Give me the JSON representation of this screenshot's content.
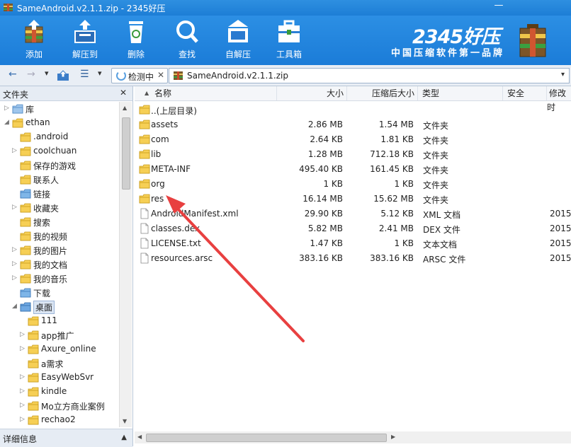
{
  "window": {
    "title": "SameAndroid.v2.1.1.zip - 2345好压",
    "minimize_glyph": "—"
  },
  "toolbar": {
    "buttons": [
      {
        "label": "添加",
        "icon": "add-archive-icon"
      },
      {
        "label": "解压到",
        "icon": "extract-icon"
      },
      {
        "label": "删除",
        "icon": "recycle-bin-icon"
      },
      {
        "label": "查找",
        "icon": "magnifier-icon"
      },
      {
        "label": "自解压",
        "icon": "self-extract-icon"
      },
      {
        "label": "工具箱",
        "icon": "toolbox-icon"
      }
    ]
  },
  "brand": {
    "logo": "2345好压",
    "slogan": "中国压缩软件第一品牌"
  },
  "addressbar": {
    "back": "←",
    "forward": "→",
    "dropdown": "▾",
    "view": "☰",
    "tab_label": "检测中",
    "tab_close": "✕",
    "path": "SameAndroid.v2.1.1.zip"
  },
  "left_panel": {
    "header": "文件夹",
    "close": "✕",
    "footer": "详细信息",
    "footer_toggle": "▲",
    "tree": [
      {
        "label": "库",
        "level": 0,
        "expand": "collapsed",
        "icon": "library-icon"
      },
      {
        "label": "ethan",
        "level": 0,
        "expand": "expanded",
        "icon": "user-folder-icon"
      },
      {
        "label": ".android",
        "level": 1,
        "expand": "none",
        "icon": "folder-icon"
      },
      {
        "label": "coolchuan",
        "level": 1,
        "expand": "collapsed",
        "icon": "folder-icon"
      },
      {
        "label": "保存的游戏",
        "level": 1,
        "expand": "none",
        "icon": "saved-games-icon"
      },
      {
        "label": "联系人",
        "level": 1,
        "expand": "none",
        "icon": "contacts-icon"
      },
      {
        "label": "链接",
        "level": 1,
        "expand": "none",
        "icon": "links-icon"
      },
      {
        "label": "收藏夹",
        "level": 1,
        "expand": "collapsed",
        "icon": "favorites-icon"
      },
      {
        "label": "搜索",
        "level": 1,
        "expand": "none",
        "icon": "search-folder-icon"
      },
      {
        "label": "我的视频",
        "level": 1,
        "expand": "none",
        "icon": "videos-icon"
      },
      {
        "label": "我的图片",
        "level": 1,
        "expand": "collapsed",
        "icon": "pictures-icon"
      },
      {
        "label": "我的文档",
        "level": 1,
        "expand": "collapsed",
        "icon": "documents-icon"
      },
      {
        "label": "我的音乐",
        "level": 1,
        "expand": "collapsed",
        "icon": "music-icon"
      },
      {
        "label": "下载",
        "level": 1,
        "expand": "none",
        "icon": "downloads-icon"
      },
      {
        "label": "桌面",
        "level": 1,
        "expand": "expanded",
        "icon": "desktop-icon",
        "selected": true
      },
      {
        "label": "111",
        "level": 2,
        "expand": "none",
        "icon": "folder-icon"
      },
      {
        "label": "app推广",
        "level": 2,
        "expand": "collapsed",
        "icon": "folder-icon"
      },
      {
        "label": "Axure_online",
        "level": 2,
        "expand": "collapsed",
        "icon": "folder-icon"
      },
      {
        "label": "a需求",
        "level": 2,
        "expand": "none",
        "icon": "folder-icon"
      },
      {
        "label": "EasyWebSvr",
        "level": 2,
        "expand": "collapsed",
        "icon": "folder-icon"
      },
      {
        "label": "kindle",
        "level": 2,
        "expand": "collapsed",
        "icon": "folder-icon"
      },
      {
        "label": "Mo立方商业案例",
        "level": 2,
        "expand": "collapsed",
        "icon": "folder-icon"
      },
      {
        "label": "rechao2",
        "level": 2,
        "expand": "collapsed",
        "icon": "folder-icon"
      }
    ]
  },
  "file_list": {
    "columns": [
      "名称",
      "大小",
      "压缩后大小",
      "类型",
      "安全",
      "修改时"
    ],
    "sort_indicator": "▲",
    "rows": [
      {
        "name": "..(上层目录)",
        "size": "",
        "packed": "",
        "type": "",
        "modified": "",
        "icon": "folder-up-icon"
      },
      {
        "name": "assets",
        "size": "2.86 MB",
        "packed": "1.54 MB",
        "type": "文件夹",
        "modified": "",
        "icon": "folder-icon"
      },
      {
        "name": "com",
        "size": "2.64 KB",
        "packed": "1.81 KB",
        "type": "文件夹",
        "modified": "",
        "icon": "folder-icon"
      },
      {
        "name": "lib",
        "size": "1.28 MB",
        "packed": "712.18 KB",
        "type": "文件夹",
        "modified": "",
        "icon": "folder-icon"
      },
      {
        "name": "META-INF",
        "size": "495.40 KB",
        "packed": "161.45 KB",
        "type": "文件夹",
        "modified": "",
        "icon": "folder-icon"
      },
      {
        "name": "org",
        "size": "1 KB",
        "packed": "1 KB",
        "type": "文件夹",
        "modified": "",
        "icon": "folder-icon"
      },
      {
        "name": "res",
        "size": "16.14 MB",
        "packed": "15.62 MB",
        "type": "文件夹",
        "modified": "",
        "icon": "folder-icon"
      },
      {
        "name": "AndroidManifest.xml",
        "size": "29.90 KB",
        "packed": "5.12 KB",
        "type": "XML 文档",
        "modified": "2015",
        "icon": "file-icon"
      },
      {
        "name": "classes.dex",
        "size": "5.82 MB",
        "packed": "2.41 MB",
        "type": "DEX 文件",
        "modified": "2015",
        "icon": "file-icon"
      },
      {
        "name": "LICENSE.txt",
        "size": "1.47 KB",
        "packed": "1 KB",
        "type": "文本文档",
        "modified": "2015",
        "icon": "file-icon"
      },
      {
        "name": "resources.arsc",
        "size": "383.16 KB",
        "packed": "383.16 KB",
        "type": "ARSC 文件",
        "modified": "2015",
        "icon": "file-icon"
      }
    ]
  },
  "annotation_arrow": {
    "icon": "red-arrow-annotation",
    "color": "#e84040"
  }
}
